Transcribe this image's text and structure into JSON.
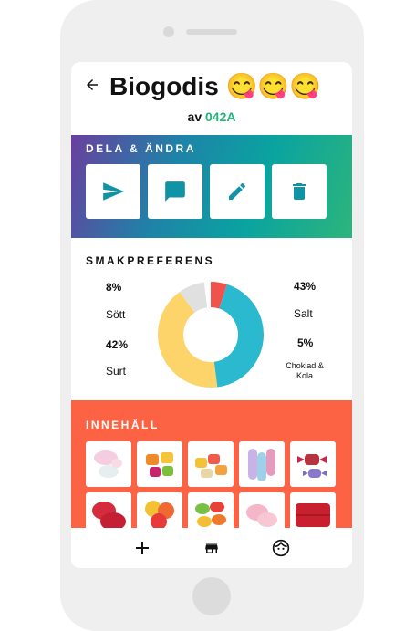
{
  "header": {
    "title": "Biogodis 😋😋😋",
    "author_prefix": "av",
    "author_code": "042A"
  },
  "share_section": {
    "title": "DELA & ÄNDRA",
    "buttons": [
      "send-icon",
      "comment-icon",
      "edit-icon",
      "delete-icon"
    ]
  },
  "taste_section": {
    "title": "SMAKPREFERENS",
    "items": [
      {
        "label": "Sött",
        "percent": "8%",
        "color": "#e0e0e0"
      },
      {
        "label": "Salt",
        "percent": "43%",
        "color": "#2bb9cf"
      },
      {
        "label": "Surt",
        "percent": "42%",
        "color": "#fdd46a"
      },
      {
        "label": "Choklad & Kola",
        "percent": "5%",
        "color": "#f0524d"
      }
    ]
  },
  "content_section": {
    "title": "INNEHÅLL",
    "thumbs": [
      "candy-1",
      "candy-2",
      "candy-3",
      "candy-4",
      "candy-5",
      "candy-6",
      "candy-7",
      "candy-8",
      "candy-9",
      "candy-10"
    ]
  },
  "bottom_nav": [
    "add-icon",
    "store-icon",
    "face-icon"
  ],
  "colors": {
    "accent_green": "#24b37d",
    "content_bg": "#fc6344"
  }
}
